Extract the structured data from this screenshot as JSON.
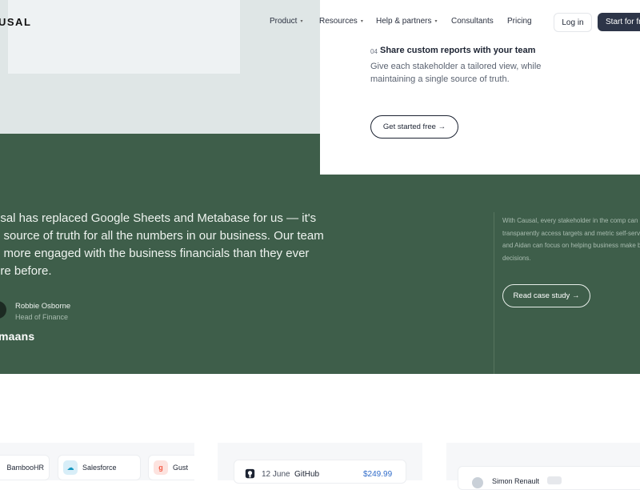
{
  "header": {
    "logo": "USAL",
    "nav": [
      {
        "label": "Product",
        "dropdown": true
      },
      {
        "label": "Resources",
        "dropdown": true
      },
      {
        "label": "Help & partners",
        "dropdown": true
      },
      {
        "label": "Consultants",
        "dropdown": false
      },
      {
        "label": "Pricing",
        "dropdown": false
      }
    ],
    "login_label": "Log in",
    "start_label": "Start for fre"
  },
  "feature": {
    "number": "04",
    "title": "Share custom reports with your team",
    "description": "Give each stakeholder a tailored view, while maintaining a single source of truth.",
    "cta_label": "Get started free →"
  },
  "testimonial": {
    "quote": "usal has replaced Google Sheets and Metabase for us — it's e source of truth for all the numbers in our business. Our team e more engaged with the business financials than they ever ere before.",
    "quote_lines": [
      "usal has replaced Google Sheets and Metabase for us — it's",
      "e source of truth for all the numbers in our business. Our team",
      "e more engaged with the business financials than they ever",
      "ere before."
    ],
    "author_name": "Robbie Osborne",
    "author_role": "Head of Finance",
    "company": "maans",
    "side_text": "With Causal, every stakeholder in the comp can transparently access targets and metric self-serve, and Aidan can focus on helping business make better decisions.",
    "cta_label": "Read case study →"
  },
  "integrations": {
    "items": [
      {
        "label": "BambooHR",
        "icon": "bamboohr-icon",
        "color": "#7cb342"
      },
      {
        "label": "Salesforce",
        "icon": "salesforce-icon",
        "color": "#1798c1"
      },
      {
        "label": "Gust",
        "icon": "gusto-icon",
        "color": "#f45d48"
      }
    ]
  },
  "transaction": {
    "date": "12 June",
    "name": "GitHub",
    "amount": "$249.99",
    "icon": "github-icon"
  },
  "person": {
    "name": "Simon Renault"
  },
  "colors": {
    "green": "#3e5e4a",
    "dark_button": "#2d3548",
    "link_blue": "#2f6bc9"
  }
}
